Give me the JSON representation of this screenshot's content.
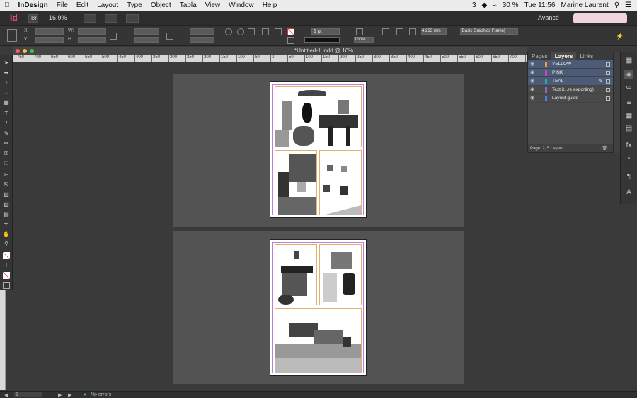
{
  "menubar": {
    "apple": "",
    "app": "InDesign",
    "items": [
      "File",
      "Edit",
      "Layout",
      "Type",
      "Object",
      "Tabla",
      "View",
      "Window",
      "Help"
    ],
    "battery": "30 %",
    "time": "Tue 11:56",
    "user": "Marine Laurent",
    "notification_count": "3"
  },
  "appbar": {
    "zoom": "16,9%",
    "workspace": "Avancé"
  },
  "controlbar": {
    "stroke_weight": "1 pt",
    "percent": "100%",
    "measure": "4,233 mm",
    "frame_style": "[Basic Graphics Frame]"
  },
  "document": {
    "tab_title": "*Untitled-1.indd @ 16%"
  },
  "ruler": {
    "ticks": [
      "750",
      "700",
      "650",
      "600",
      "550",
      "500",
      "450",
      "400",
      "350",
      "300",
      "250",
      "200",
      "150",
      "100",
      "50",
      "0",
      "50",
      "100",
      "150",
      "200",
      "250",
      "300",
      "350",
      "400",
      "450",
      "500",
      "550",
      "600",
      "650",
      "700",
      "750"
    ]
  },
  "layers_panel": {
    "tabs": [
      "Pages",
      "Layers",
      "Links"
    ],
    "active_tab": "Layers",
    "layers": [
      {
        "name": "YELLOW",
        "color": "#f0a020",
        "selected": true
      },
      {
        "name": "PINK",
        "color": "#d040c0",
        "selected": true
      },
      {
        "name": "TEAL",
        "color": "#20b0b0",
        "selected": true
      },
      {
        "name": "Text it...re exporting)",
        "color": "#9060d0",
        "selected": false
      },
      {
        "name": "Layout guide",
        "color": "#4080f0",
        "selected": false
      }
    ],
    "footer": "Page: 2, 5 Layers"
  },
  "status": {
    "page": "1",
    "errors": "No errors"
  },
  "colors": {
    "indesign_brand": "#ff4f8b",
    "selection": "#4c5c78",
    "margin_guide": "#c080d0",
    "column_guide": "#e0b070"
  }
}
